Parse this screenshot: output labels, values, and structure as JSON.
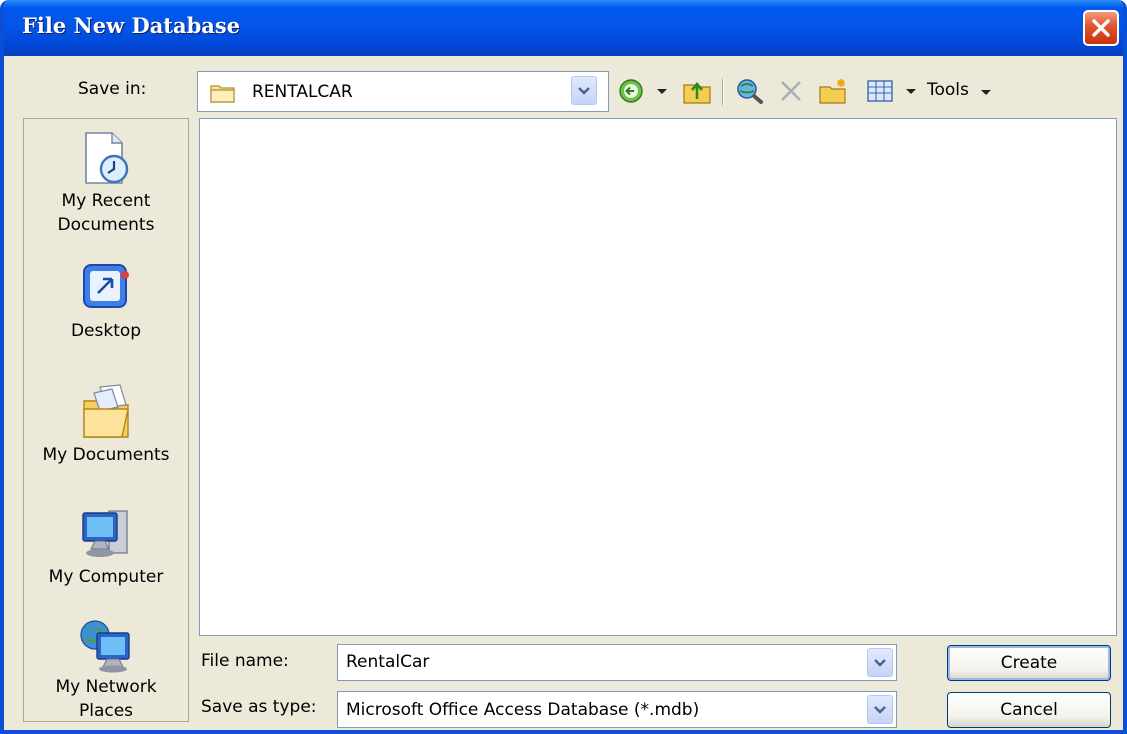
{
  "window": {
    "title": "File New Database"
  },
  "toolbar": {
    "save_in_label": "Save in:",
    "save_in_value": "RENTALCAR",
    "tools_label": "Tools"
  },
  "places": [
    {
      "label_line1": "My Recent",
      "label_line2": "Documents",
      "icon": "recent-documents-icon"
    },
    {
      "label_line1": "Desktop",
      "label_line2": "",
      "icon": "desktop-icon"
    },
    {
      "label_line1": "My Documents",
      "label_line2": "",
      "icon": "my-documents-icon"
    },
    {
      "label_line1": "My Computer",
      "label_line2": "",
      "icon": "my-computer-icon"
    },
    {
      "label_line1": "My Network",
      "label_line2": "Places",
      "icon": "network-places-icon"
    }
  ],
  "form": {
    "file_name_label": "File name:",
    "file_name_value": "RentalCar",
    "save_as_type_label": "Save as type:",
    "save_as_type_value": "Microsoft Office Access Database (*.mdb)"
  },
  "buttons": {
    "create": "Create",
    "cancel": "Cancel"
  },
  "colors": {
    "title_bar": "#0454e6",
    "dialog_face": "#ece9d8",
    "close_button": "#e0532d",
    "field_border": "#7f9db9"
  }
}
